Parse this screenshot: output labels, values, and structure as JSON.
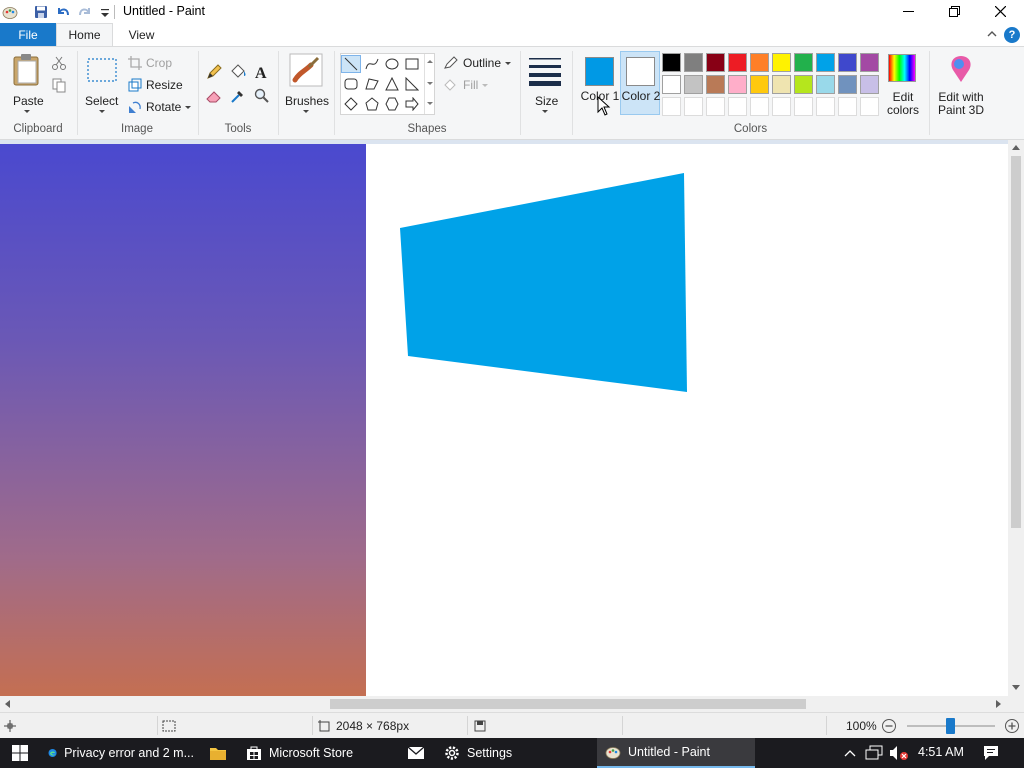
{
  "window": {
    "title": "Untitled - Paint"
  },
  "tabs": {
    "file": "File",
    "home": "Home",
    "view": "View"
  },
  "clipboard": {
    "paste_label": "Paste",
    "group_label": "Clipboard"
  },
  "image": {
    "select_label": "Select",
    "crop_label": "Crop",
    "resize_label": "Resize",
    "rotate_label": "Rotate",
    "group_label": "Image"
  },
  "tools": {
    "group_label": "Tools"
  },
  "brushes": {
    "label": "Brushes"
  },
  "shapes": {
    "outline_label": "Outline",
    "fill_label": "Fill",
    "group_label": "Shapes"
  },
  "size": {
    "label": "Size"
  },
  "colors": {
    "color1_label": "Color 1",
    "color2_label": "Color 2",
    "color1_value": "#0099e5",
    "color2_value": "#ffffff",
    "edit_colors_label": "Edit colors",
    "paint3d_label": "Edit with Paint 3D",
    "group_label": "Colors",
    "palette_row1": [
      "#000000",
      "#7f7f7f",
      "#880015",
      "#ed1c24",
      "#ff7f27",
      "#fff200",
      "#22b14c",
      "#00a2e8",
      "#3f48cc",
      "#a349a4"
    ],
    "palette_row2": [
      "#ffffff",
      "#c3c3c3",
      "#b97a57",
      "#ffaec9",
      "#ffc90e",
      "#efe4b0",
      "#b5e61d",
      "#99d9ea",
      "#7092be",
      "#c8bfe7"
    ]
  },
  "canvas": {
    "shape_fill": "#00a2e8",
    "gradient_colors": [
      "#4a49cf",
      "#c46f52"
    ]
  },
  "status": {
    "dimensions": "2048 × 768px",
    "zoom": "100%"
  },
  "taskbar": {
    "items": [
      {
        "label": "Privacy error and 2 m..."
      },
      {
        "label": "Microsoft Store"
      },
      {
        "label": "Settings"
      },
      {
        "label": "Untitled - Paint"
      }
    ],
    "time": "4:51 AM"
  }
}
